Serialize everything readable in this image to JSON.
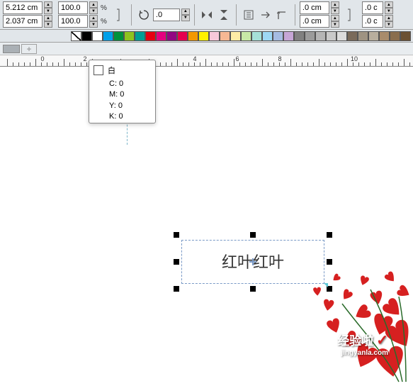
{
  "toolbar": {
    "width_value": "5.212 cm",
    "height_value": "2.037 cm",
    "scale_x": "100.0",
    "scale_y": "100.0",
    "scale_unit": "%",
    "rotation": ".0",
    "nudge_x": ".0 cm",
    "nudge_y": ".0 cm",
    "nudge_step1": ".0 c",
    "nudge_step2": ".0 c"
  },
  "palette": [
    "none",
    "#000000",
    "#ffffff",
    "#00a0e9",
    "#00913a",
    "#8fc31f",
    "#009e96",
    "#e60012",
    "#e4007f",
    "#920783",
    "#e5004f",
    "#f39800",
    "#fff100",
    "#f7c8da",
    "#f6b894",
    "#fdeca6",
    "#c8e8a6",
    "#a6e0d8",
    "#9ed8f5",
    "#a6bce2",
    "#c6a6d6",
    "#808080",
    "#9b9b9b",
    "#b5b5b5",
    "#c9c9c9",
    "#dcdcdc",
    "#7a6a5a",
    "#9e9382",
    "#b8ae9e",
    "#a98c6c",
    "#8a6e4e",
    "#6b5032"
  ],
  "sub_palette": [
    "#aab0b5"
  ],
  "ruler_labels": [
    {
      "pos": 60,
      "text": "0"
    },
    {
      "pos": 120,
      "text": "2"
    },
    {
      "pos": 275,
      "text": "4"
    },
    {
      "pos": 335,
      "text": "6"
    },
    {
      "pos": 395,
      "text": "8"
    },
    {
      "pos": 500,
      "text": "10"
    }
  ],
  "tooltip": {
    "name": "白",
    "c": "C: 0",
    "m": "M: 0",
    "y": "Y: 0",
    "k": "K: 0",
    "swatch_color": "#ffffff"
  },
  "selection": {
    "text": "红叶红叶"
  },
  "watermark": {
    "title": "经验啦",
    "sub": "jingyanla.com",
    "check": "✓"
  }
}
